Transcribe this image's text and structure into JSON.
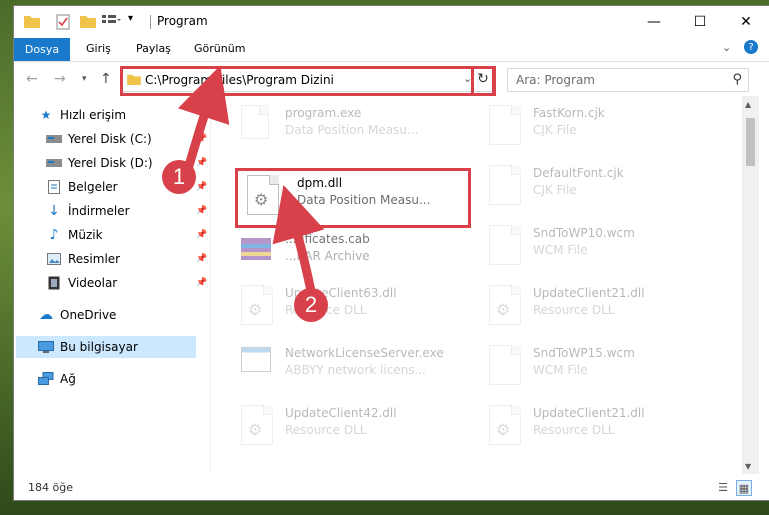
{
  "window": {
    "title": "Program"
  },
  "ribbon": {
    "file": "Dosya",
    "tabs": [
      "Giriş",
      "Paylaş",
      "Görünüm"
    ]
  },
  "address": {
    "path": "C:\\Program Files\\Program Dizini"
  },
  "search": {
    "placeholder": "Ara: Program"
  },
  "sidebar": {
    "items": [
      {
        "label": "Hızlı erişim"
      },
      {
        "label": "Yerel Disk (C:)"
      },
      {
        "label": "Yerel Disk (D:)"
      },
      {
        "label": "Belgeler"
      },
      {
        "label": "İndirmeler"
      },
      {
        "label": "Müzik"
      },
      {
        "label": "Resimler"
      },
      {
        "label": "Videolar"
      },
      {
        "label": "OneDrive"
      },
      {
        "label": "Bu bilgisayar"
      },
      {
        "label": "Ağ"
      }
    ]
  },
  "files": [
    {
      "name": "program.exe",
      "type": "Data Position Measu..."
    },
    {
      "name": "FastKorn.cjk",
      "type": "CJK File"
    },
    {
      "name": "dpm.dll",
      "type": "Data Position Measu..."
    },
    {
      "name": "DefaultFont.cjk",
      "type": "CJK File"
    },
    {
      "name": "...tificates.cab",
      "type": "...RAR Archive"
    },
    {
      "name": "SndToWP10.wcm",
      "type": "WCM File"
    },
    {
      "name": "UpdateClient63.dll",
      "type": "Resource DLL"
    },
    {
      "name": "UpdateClient21.dll",
      "type": "Resource DLL"
    },
    {
      "name": "NetworkLicenseServer.exe",
      "type": "ABBYY network licens..."
    },
    {
      "name": "SndToWP15.wcm",
      "type": "WCM File"
    },
    {
      "name": "UpdateClient42.dll",
      "type": "Resource DLL"
    },
    {
      "name": "UpdateClient21.dll",
      "type": "Resource DLL"
    }
  ],
  "status": {
    "count": "184 öğe"
  },
  "annotations": {
    "badge1": "1",
    "badge2": "2"
  },
  "colors": {
    "accent": "#1979ca",
    "highlight": "#d9414a",
    "selection": "#cce8ff"
  }
}
